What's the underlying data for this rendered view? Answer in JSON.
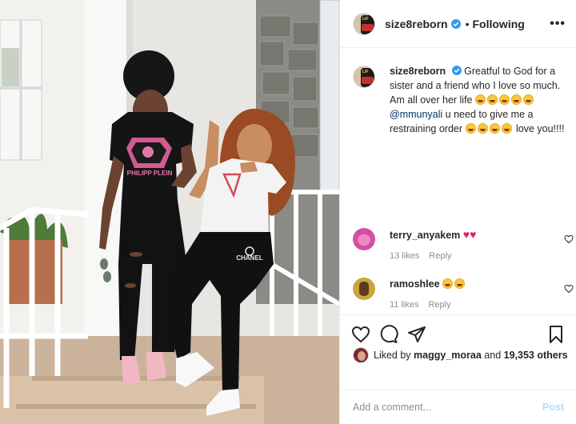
{
  "post": {
    "author": "size8reborn",
    "follow_status": "Following",
    "separator": "•",
    "more_label": "•••"
  },
  "caption": {
    "username": "size8reborn",
    "text_part1": "Greatful to God for a sister and a friend who I love so much. Am all over her life",
    "mention": "@mmunyali",
    "text_part2": "u need to give me a restraining order",
    "text_part3": "love you!!!!"
  },
  "comments": [
    {
      "username": "terry_anyakem",
      "likes": "13 likes",
      "reply": "Reply"
    },
    {
      "username": "ramoshlee",
      "likes": "11 likes",
      "reply": "Reply"
    }
  ],
  "likes": {
    "prefix": "Liked by",
    "user": "maggy_moraa",
    "and": "and",
    "count": "19,353 others"
  },
  "composer": {
    "placeholder": "Add a comment...",
    "post_label": "Post"
  },
  "photo": {
    "shirt_left_text": "PHILIPP PLEIN",
    "pants_right_text": "CHANEL"
  },
  "icons": {
    "verified": "verified-badge-icon",
    "like": "heart-icon",
    "comment": "comment-bubble-icon",
    "share": "paper-plane-icon",
    "save": "bookmark-icon"
  },
  "colors": {
    "verified": "#3897f0",
    "heart": "#e0245e",
    "link": "#00376b",
    "muted": "#8e8e8e",
    "post_disabled": "#b3dbff"
  }
}
